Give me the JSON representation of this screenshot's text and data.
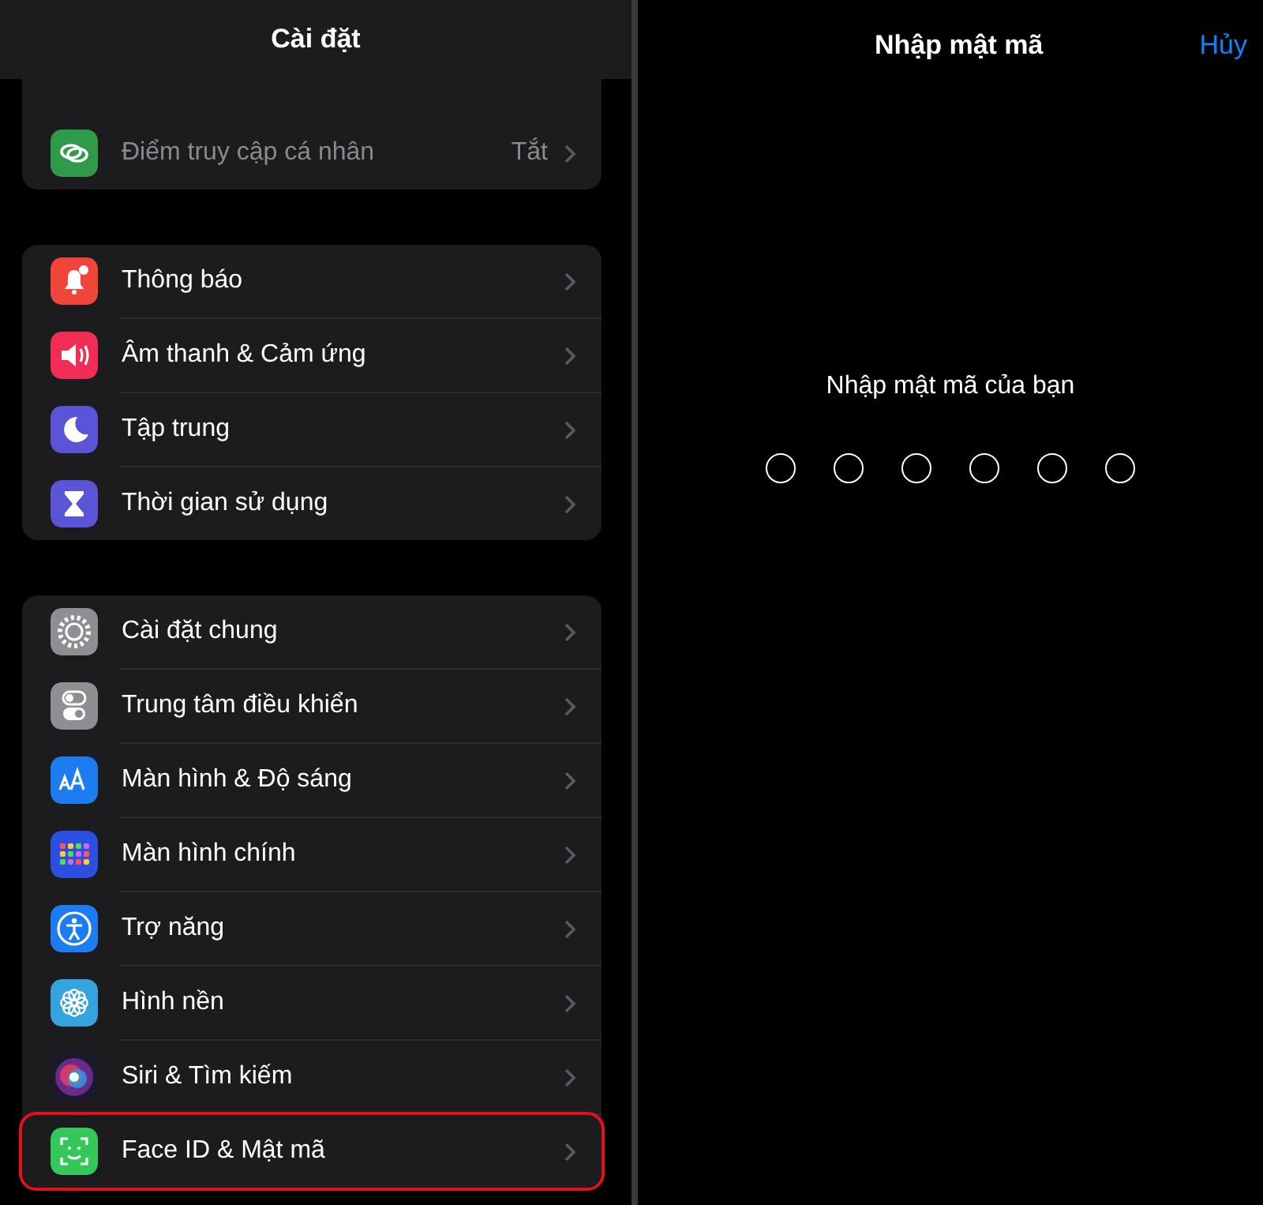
{
  "settings": {
    "title": "Cài đặt",
    "groups": [
      {
        "items": [
          {
            "label": "Điểm truy cập cá nhân",
            "value": "Tắt",
            "color": "#2f9a4a",
            "disabled": true,
            "highlighted": false
          }
        ]
      },
      {
        "items": [
          {
            "label": "Thông báo",
            "color": "#f0453a",
            "disabled": false,
            "highlighted": false
          },
          {
            "label": "Âm thanh & Cảm ứng",
            "color": "#f12d55",
            "disabled": false,
            "highlighted": false
          },
          {
            "label": "Tập trung",
            "color": "#5a55d6",
            "disabled": false,
            "highlighted": false
          },
          {
            "label": "Thời gian sử dụng",
            "color": "#5a55d6",
            "disabled": false,
            "highlighted": false
          }
        ]
      },
      {
        "items": [
          {
            "label": "Cài đặt chung",
            "color": "#8e8e93",
            "disabled": false,
            "highlighted": false
          },
          {
            "label": "Trung tâm điều khiển",
            "color": "#8e8e93",
            "disabled": false,
            "highlighted": false
          },
          {
            "label": "Màn hình & Độ sáng",
            "color": "#1e7cf2",
            "disabled": false,
            "highlighted": false
          },
          {
            "label": "Màn hình chính",
            "color": "#2d4fe0",
            "disabled": false,
            "highlighted": false
          },
          {
            "label": "Trợ năng",
            "color": "#1e7cf2",
            "disabled": false,
            "highlighted": false
          },
          {
            "label": "Hình nền",
            "color": "#35a4dc",
            "disabled": false,
            "highlighted": false
          },
          {
            "label": "Siri & Tìm kiếm",
            "color": "#1a1a2a",
            "disabled": false,
            "highlighted": false
          },
          {
            "label": "Face ID & Mật mã",
            "color": "#34c759",
            "disabled": false,
            "highlighted": true
          }
        ]
      }
    ]
  },
  "passcode": {
    "title": "Nhập mật mã",
    "cancel": "Hủy",
    "prompt": "Nhập mật mã của bạn",
    "digits": [
      {
        "filled": false
      },
      {
        "filled": false
      },
      {
        "filled": false
      },
      {
        "filled": false
      },
      {
        "filled": false
      },
      {
        "filled": false
      }
    ]
  }
}
